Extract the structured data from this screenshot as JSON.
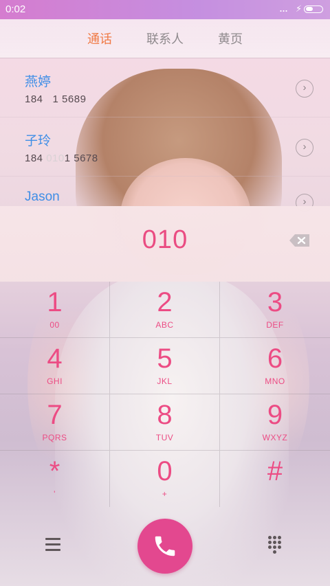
{
  "status_bar": {
    "time": "0:02",
    "dots": "...",
    "bolt": "⚡"
  },
  "tabs": [
    {
      "label": "通话",
      "active": true
    },
    {
      "label": "联系人",
      "active": false
    },
    {
      "label": "黄页",
      "active": false
    }
  ],
  "contacts": [
    {
      "name": "燕婷",
      "number_before": "184",
      "number_match": "   ",
      "number_after": "1 5689"
    },
    {
      "name": "子玲",
      "number_before": "184 ",
      "number_match": "010",
      "number_after": "1 5678"
    },
    {
      "name": "Jason",
      "number_before": "",
      "number_match": "",
      "number_after": ""
    }
  ],
  "display": {
    "digits": "010"
  },
  "keypad": [
    {
      "num": "1",
      "letters": "00"
    },
    {
      "num": "2",
      "letters": "ABC"
    },
    {
      "num": "3",
      "letters": "DEF"
    },
    {
      "num": "4",
      "letters": "GHI"
    },
    {
      "num": "5",
      "letters": "JKL"
    },
    {
      "num": "6",
      "letters": "MNO"
    },
    {
      "num": "7",
      "letters": "PQRS"
    },
    {
      "num": "8",
      "letters": "TUV"
    },
    {
      "num": "9",
      "letters": "WXYZ"
    },
    {
      "num": "*",
      "letters": "'"
    },
    {
      "num": "0",
      "letters": "+"
    },
    {
      "num": "#",
      "letters": ""
    }
  ],
  "colors": {
    "accent_pink": "#ea4c82",
    "tab_active": "#f07a45",
    "contact_name": "#3f8ee6",
    "call_button": "#e3488f"
  },
  "icons": {
    "backspace": "backspace-icon",
    "call": "phone-icon",
    "menu": "menu-icon",
    "dialpad": "dialpad-icon"
  }
}
